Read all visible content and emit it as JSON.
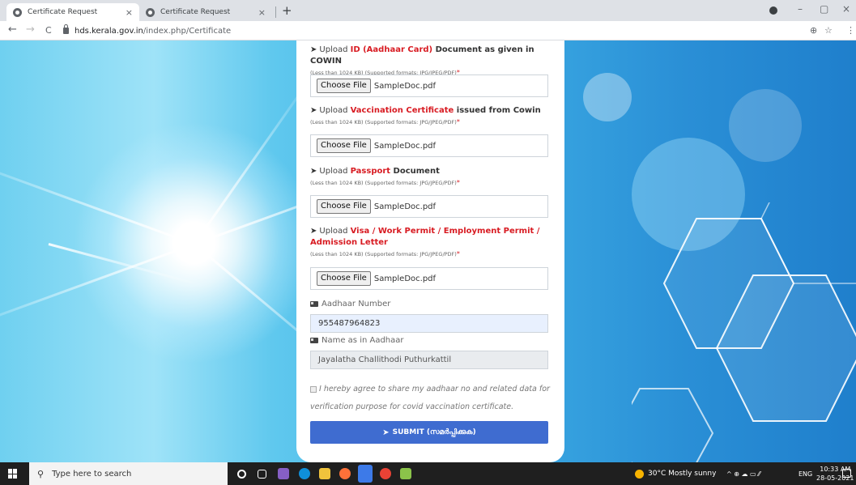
{
  "browser": {
    "tabs": [
      {
        "title": "Certificate Request",
        "active": true
      },
      {
        "title": "Certificate Request",
        "active": false
      }
    ],
    "close_glyph": "×",
    "new_tab_glyph": "+",
    "url_host": "hds.kerala.gov.in",
    "url_path": "/index.php/Certificate",
    "nav": {
      "back": "←",
      "forward": "→",
      "reload": "C"
    },
    "toolbar_icons": {
      "zoom": "⊕",
      "star": "☆",
      "menu": "⋮"
    },
    "window_controls": {
      "minimize": "–",
      "maximize": "▢",
      "close": "×"
    }
  },
  "form": {
    "uploads": [
      {
        "prefix": "Upload ",
        "highlight": "ID (Aadhaar Card)",
        "suffix": " Document as given in COWIN",
        "note": "(Less than 1024 KB) (Supported formats: JPG/JPEG/PDF)",
        "button": "Choose File",
        "file": "SampleDoc.pdf"
      },
      {
        "prefix": "Upload ",
        "highlight": "Vaccination Certificate",
        "suffix": " issued from Cowin",
        "note": "(Less than 1024 KB) (Supported formats: JPG/JPEG/PDF)",
        "button": "Choose File",
        "file": "SampleDoc.pdf"
      },
      {
        "prefix": "Upload ",
        "highlight": "Passport",
        "suffix": " Document",
        "note": "(Less than 1024 KB) (Supported formats: JPG/JPEG/PDF)",
        "button": "Choose File",
        "file": "SampleDoc.pdf"
      },
      {
        "prefix": "Upload ",
        "highlight": "Visa / Work Permit / Employment Permit / Admission Letter",
        "suffix": "",
        "note": "(Less than 1024 KB) (Supported formats: JPG/JPEG/PDF)",
        "button": "Choose File",
        "file": "SampleDoc.pdf"
      }
    ],
    "required_mark": "*",
    "aadhaar_label": "Aadhaar Number",
    "aadhaar_value": "955487964823",
    "name_label": "Name as in Aadhaar",
    "name_value": "Jayalatha Challithodi Puthurkattil",
    "agree_text": "I hereby agree to share my aadhaar no and related data for verification purpose for covid vaccination certificate.",
    "submit_label": "SUBMIT (സമർപ്പിക്കുക)"
  },
  "taskbar": {
    "search_placeholder": "Type here to search",
    "weather": "30°C  Mostly sunny",
    "tray_glyphs": "^  ⊕  ☁  ▭  ⁄⁄",
    "lang": "ENG",
    "time": "10:33 AM",
    "date": "28-05-2021"
  },
  "colors": {
    "accent_red": "#d81b22",
    "submit_blue": "#3f6cd0"
  }
}
